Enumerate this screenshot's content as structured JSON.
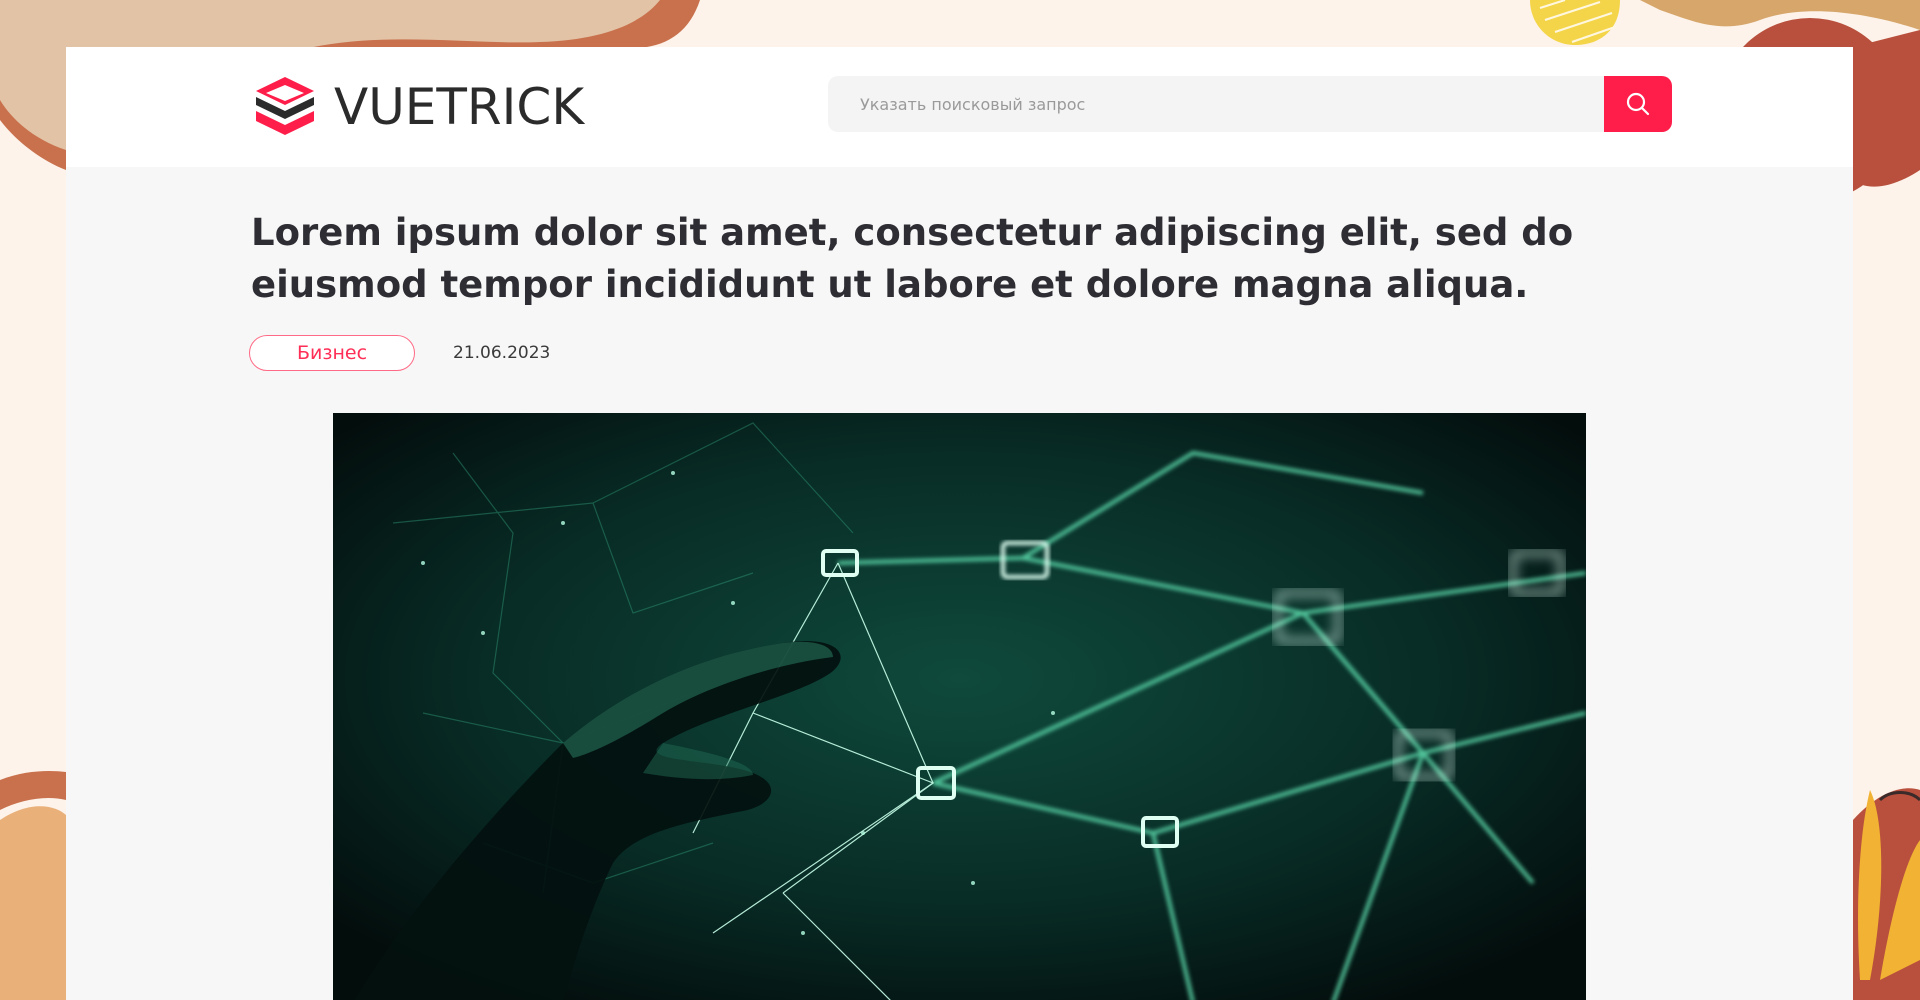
{
  "brand": {
    "name": "VUETRICK",
    "accent_color": "#ff1e4a",
    "dark_color": "#2b2b2b"
  },
  "search": {
    "placeholder": "Указать поисковый запрос",
    "value": "",
    "button_icon": "search-icon"
  },
  "article": {
    "title": "Lorem ipsum dolor sit amet, consectetur adipiscing elit, sed do eiusmod tempor incididunt ut labore et dolore magna aliqua.",
    "category": "Бизнес",
    "date": "21.06.2023",
    "hero_image": "network-hand-illustration"
  }
}
